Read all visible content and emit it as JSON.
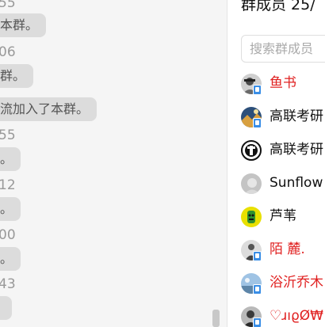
{
  "chat": {
    "items": [
      {
        "time": "55",
        "notice": "本群。"
      },
      {
        "time": "06",
        "notice": "群。"
      },
      {
        "time": "",
        "notice": "流加入了本群。"
      },
      {
        "time": "55",
        "notice": "。"
      },
      {
        "time": "12",
        "notice": "。"
      },
      {
        "time": "00",
        "notice": "。"
      },
      {
        "time": "43",
        "notice": ""
      }
    ]
  },
  "members_panel": {
    "title": "群成员 25/",
    "search_placeholder": "搜索群成员",
    "members": [
      {
        "name": "鱼书",
        "color": "#e02020",
        "avatar": "person-photo-icon"
      },
      {
        "name": "高联考研",
        "color": "#111111",
        "avatar": "mountain-photo-icon"
      },
      {
        "name": "高联考研",
        "color": "#111111",
        "avatar": "logo-emblem-icon"
      },
      {
        "name": "Sunflow",
        "color": "#111111",
        "avatar": "sketch-avatar-icon"
      },
      {
        "name": "芦苇",
        "color": "#111111",
        "avatar": "cartoon-avatar-icon"
      },
      {
        "name": "陌  麓.",
        "color": "#e02020",
        "avatar": "person-photo-icon"
      },
      {
        "name": "浴沂乔木",
        "color": "#e02020",
        "avatar": "sky-photo-icon"
      },
      {
        "name": "♡ɹıϱØ₩",
        "color": "#e02020",
        "avatar": "person-photo-icon"
      }
    ]
  },
  "colors": {
    "chat_background": "#f5f5f5",
    "notice_bubble": "#dcdcdc",
    "admin_name": "#e02020",
    "badge_blue": "#3a8ee6"
  }
}
